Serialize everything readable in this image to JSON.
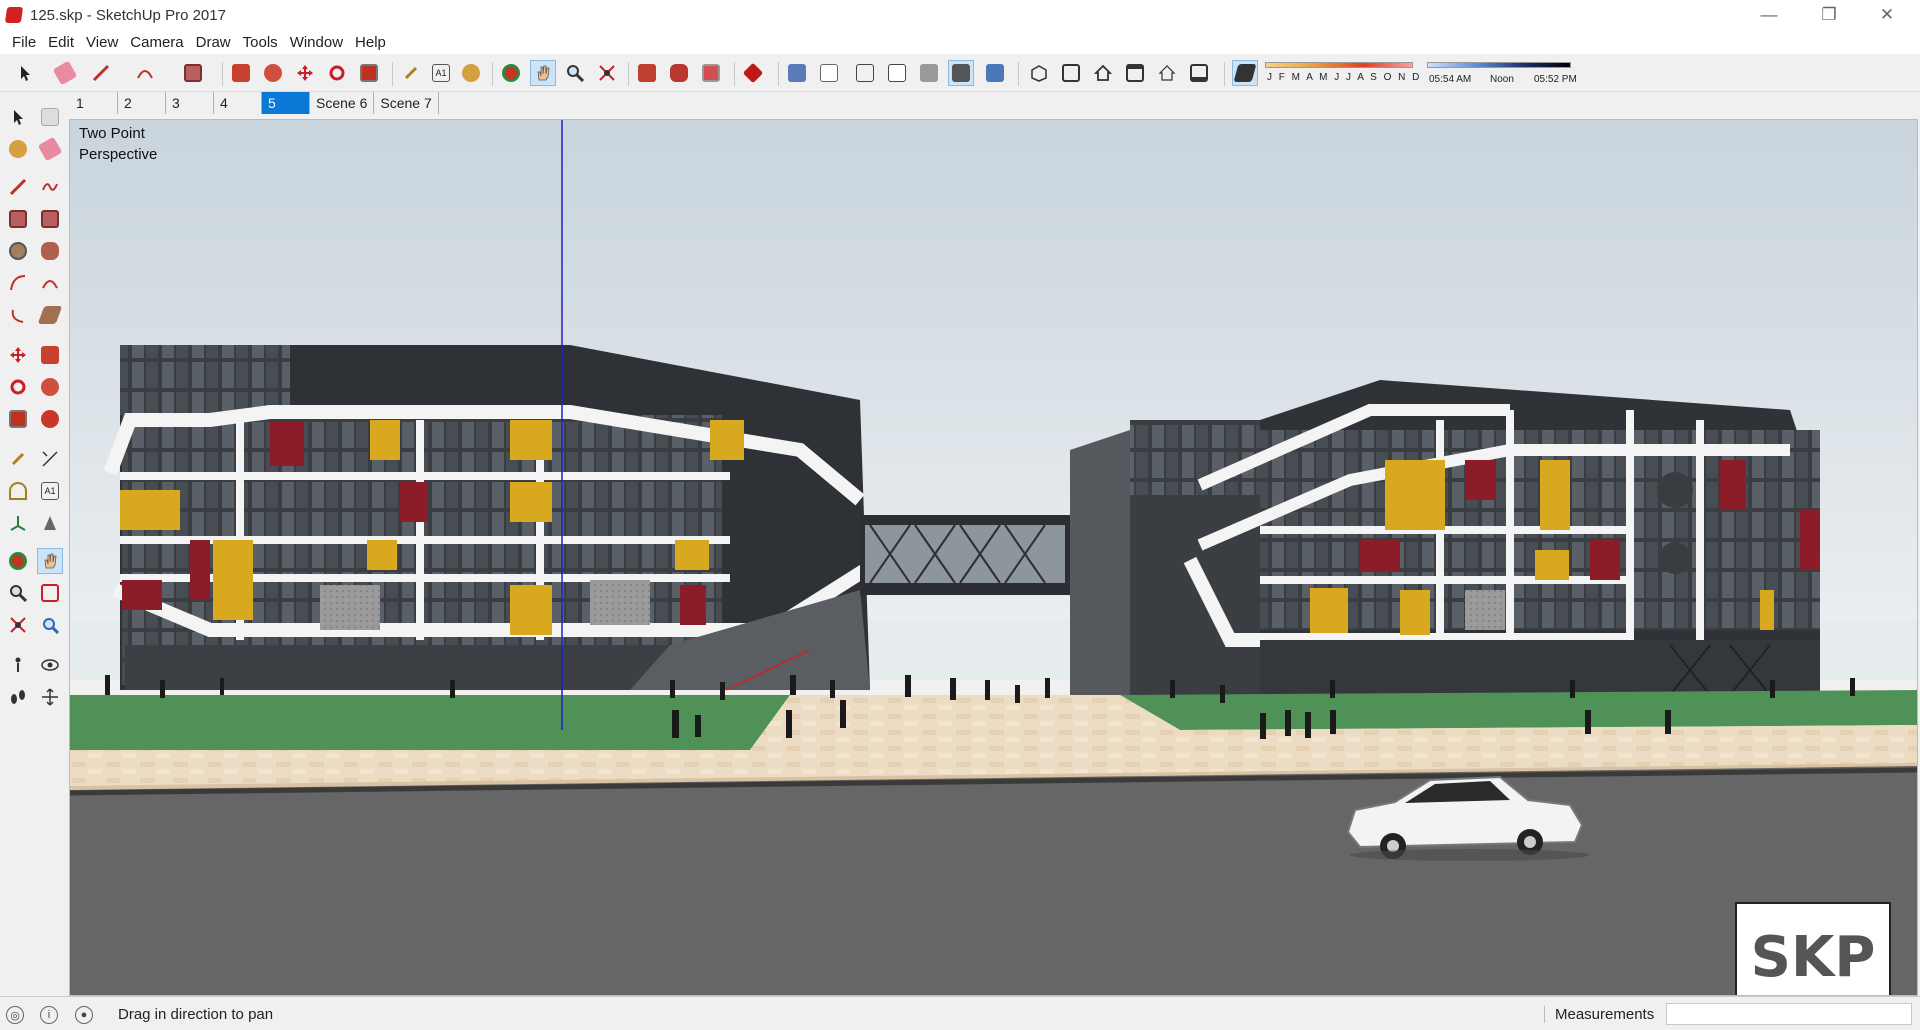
{
  "window": {
    "title": "125.skp - SketchUp Pro 2017",
    "controls": {
      "minimize": "—",
      "restore": "❐",
      "close": "✕"
    }
  },
  "menu": [
    "File",
    "Edit",
    "View",
    "Camera",
    "Draw",
    "Tools",
    "Window",
    "Help"
  ],
  "toolbar": {
    "shadow": {
      "months": "J F M A M J J A S O N D",
      "time_start": "05:54 AM",
      "time_mid": "Noon",
      "time_end": "05:52 PM"
    }
  },
  "scenes": {
    "tabs": [
      "1",
      "2",
      "3",
      "4",
      "5",
      "Scene 6",
      "Scene 7"
    ],
    "active": "5"
  },
  "viewport": {
    "camera_line1": "Two Point",
    "camera_line2": "Perspective",
    "watermark": "SKP",
    "colors": {
      "sky": "#dde4ea",
      "grass": "#4f9157",
      "paving": "#ecdcc3",
      "road": "#666666",
      "accent_yellow": "#d8a81e",
      "accent_red": "#8c1c28"
    }
  },
  "status": {
    "hint": "Drag in direction to pan",
    "measurements_label": "Measurements",
    "measurements_value": ""
  }
}
